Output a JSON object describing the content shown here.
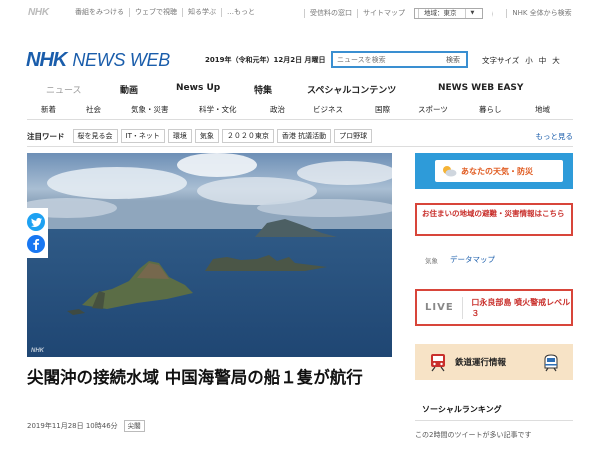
{
  "util": {
    "logo": "NHK",
    "links": [
      "番組をみつける",
      "ウェブで視聴",
      "知る学ぶ",
      "…もっと"
    ],
    "right_links": [
      "受信料の窓口",
      "サイトマップ"
    ],
    "region_label": "地域：東京",
    "all_site": "NHK 全体から検索"
  },
  "header": {
    "logo_nhk": "NHK",
    "logo_news": "NEWS WEB",
    "date": "2019年（令和元年）12月2日 月曜日",
    "search_placeholder": "ニュースを検索",
    "search_button": "検索",
    "font_size_label": "文字サイズ",
    "font_sizes": [
      "小",
      "中",
      "大"
    ]
  },
  "main_nav": [
    "ニュース",
    "動画",
    "News Up",
    "特集",
    "スペシャルコンテンツ",
    "NEWS WEB EASY"
  ],
  "sub_nav": [
    "新着",
    "社会",
    "気象・災害",
    "科学・文化",
    "政治",
    "ビジネス",
    "国際",
    "スポーツ",
    "暮らし",
    "地域"
  ],
  "attention": {
    "label": "注目ワード",
    "tags": [
      "桜を見る会",
      "IT・ネット",
      "環境",
      "気象",
      "２０２０東京",
      "香港 抗議活動",
      "プロ野球"
    ],
    "more": "もっと見る"
  },
  "article": {
    "image_credit": "NHK",
    "headline": "尖閣沖の接続水域 中国海警局の船１隻が航行",
    "date": "2019年11月28日 10時46分",
    "category": "尖閣"
  },
  "sidebar": {
    "weather": "あなたの天気・防災",
    "evac": "お住まいの地域の避難・災害情報はこちら",
    "datamap_key": "気象",
    "datamap_value": "データマップ",
    "live_label": "LIVE",
    "live_text": "口永良部島 噴火警戒レベル３",
    "train": "鉄道運行情報",
    "social_title": "ソーシャルランキング",
    "social_note": "この2時間のツイートが多い記事です"
  },
  "colors": {
    "brand_blue": "#1a5dab",
    "search_border": "#3a8fd1",
    "alert_red": "#d8453a",
    "weather_blue": "#2e9bd9",
    "train_bg": "#f7e3c6"
  }
}
